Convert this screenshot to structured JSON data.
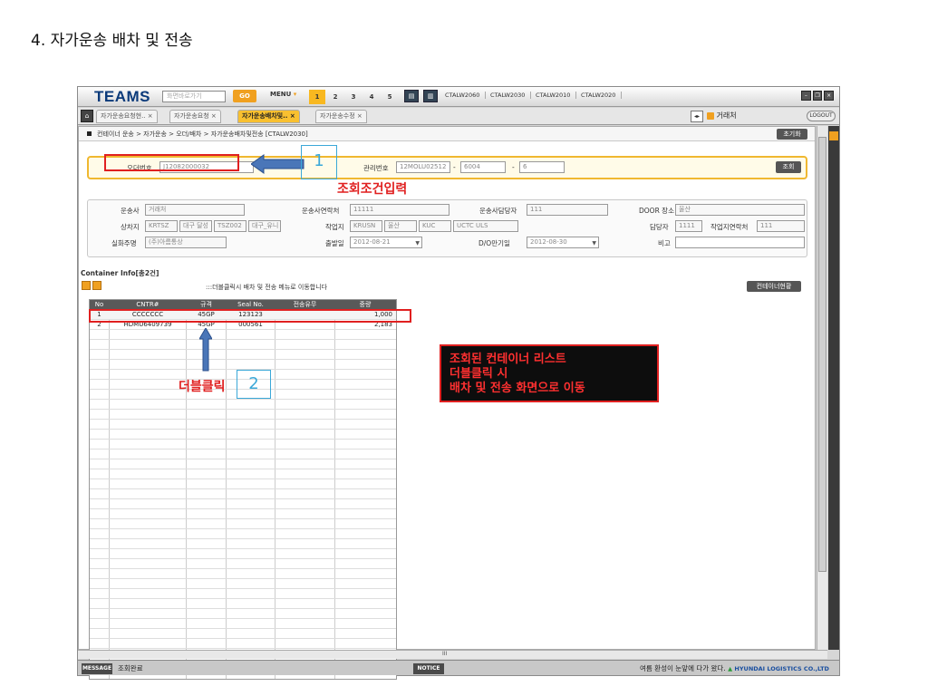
{
  "heading": "4. 자가운송 배차 및 전송",
  "topbar": {
    "logo": "TEAMS",
    "search_placeholder": "화면바로가기",
    "go": "GO",
    "menu": "MENU",
    "pages": [
      "1",
      "2",
      "3",
      "4",
      "5"
    ],
    "screens": [
      "CTALW2060",
      "CTALW2030",
      "CTALW2010",
      "CTALW2020"
    ]
  },
  "tabs": [
    "자가운송요청현..",
    "자가운송요청",
    "자가운송배차및..",
    "자가운송수정"
  ],
  "tab_close": "×",
  "account": "거래처",
  "logout": "LOGOUT",
  "breadcrumb": "컨테이너 운송 > 자가운송 > 오더/배차 > 자가운송배차및전송 [CTALW2030]",
  "reset_button": "초기화",
  "search": {
    "order_label": "오더번호",
    "order_value": "J12082000032",
    "mgmt_label": "관리번호",
    "mgmt_value1": "12MOLU02512",
    "mgmt_value2": "6004",
    "mgmt_value3": "6",
    "dash": "-",
    "query_button": "조회"
  },
  "annotations": {
    "num1": "1",
    "condition_text": "조회조건입력",
    "num2": "2",
    "dblclick_text": "더블클릭",
    "list_line1": "조회된 컨테이너 리스트",
    "list_line2": "더블클릭 시",
    "list_line3": "배차 및 전송 화면으로 이동"
  },
  "info": {
    "carrier_label": "운송사",
    "carrier_value": "거래처",
    "carrier_contact_label": "운송사연락처",
    "carrier_contact_value": "11111",
    "carrier_manager_label": "운송사담당자",
    "carrier_manager_value": "111",
    "door_label": "DOOR 장소",
    "door_value": "울산",
    "loading_label": "상차지",
    "loading_code": "KRTSZ",
    "loading_name": "대구 달성",
    "loading_code2": "TSZ002",
    "loading_name2": "대구_유니",
    "work_label": "작업지",
    "work_code": "KRUSN",
    "work_name": "울산",
    "work_code2": "KUC",
    "work_name2": "UCTC ULS",
    "manager_label": "담당자",
    "manager_value": "1111",
    "work_contact_label": "작업지연락처",
    "work_contact_value": "111",
    "shipper_label": "실화주명",
    "shipper_value": "(주)아름통상",
    "depart_label": "출발일",
    "depart_value": "2012-08-21",
    "do_label": "D/O만기일",
    "do_value": "2012-08-30",
    "remark_label": "비고",
    "remark_value": "",
    "dropdown": "▼"
  },
  "container": {
    "title": "Container Info[총2건]",
    "hint": ":::더블클릭시 배차 및 전송 메뉴로 이동합니다",
    "status_button": "컨테이너현황",
    "columns": [
      "No",
      "CNTR#",
      "규격",
      "Seal No.",
      "전송유무",
      "중량"
    ],
    "rows": [
      [
        "1",
        "CCCCCCC",
        "45GP",
        "123123",
        "",
        "1,000"
      ],
      [
        "2",
        "HDMU6409739",
        "45GP",
        "000561",
        "",
        "2,183"
      ]
    ]
  },
  "hscroll_center": "III",
  "status": {
    "message_label": "MESSAGE",
    "message": "조회완료",
    "notice_label": "NOTICE",
    "notice_text": "여름 환성이 눈앞에 다가 왔다.",
    "brand": "HYUNDAI LOGISTICS CO.,LTD"
  },
  "colors": {
    "accent": "#f8b820",
    "annotation_red": "#e02020",
    "annotation_blue": "#3ba8d8",
    "header_dark": "#595959"
  }
}
